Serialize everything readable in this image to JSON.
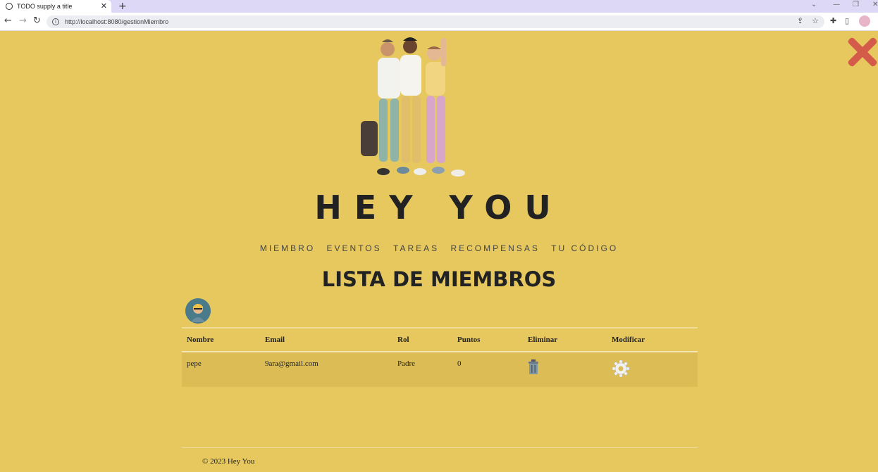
{
  "browser": {
    "tab_title": "TODO supply a title",
    "url": "http://localhost:8080/gestionMiembro"
  },
  "page": {
    "brand": "HEY YOU",
    "heading": "LISTA DE MIEMBROS",
    "nav": [
      "MIEMBRO",
      "EVENTOS",
      "TAREAS",
      "RECOMPENSAS",
      "TU CÓDIGO"
    ],
    "table": {
      "headers": [
        "Nombre",
        "Email",
        "Rol",
        "Puntos",
        "Eliminar",
        "Modificar"
      ],
      "rows": [
        {
          "nombre": "pepe",
          "email": "9ara@gmail.com",
          "rol": "Padre",
          "puntos": "0"
        }
      ]
    },
    "footer": "© 2023 Hey You"
  },
  "colors": {
    "background": "#e6c85e",
    "row_bg": "#dcbd55",
    "close": "#d45a4a"
  }
}
